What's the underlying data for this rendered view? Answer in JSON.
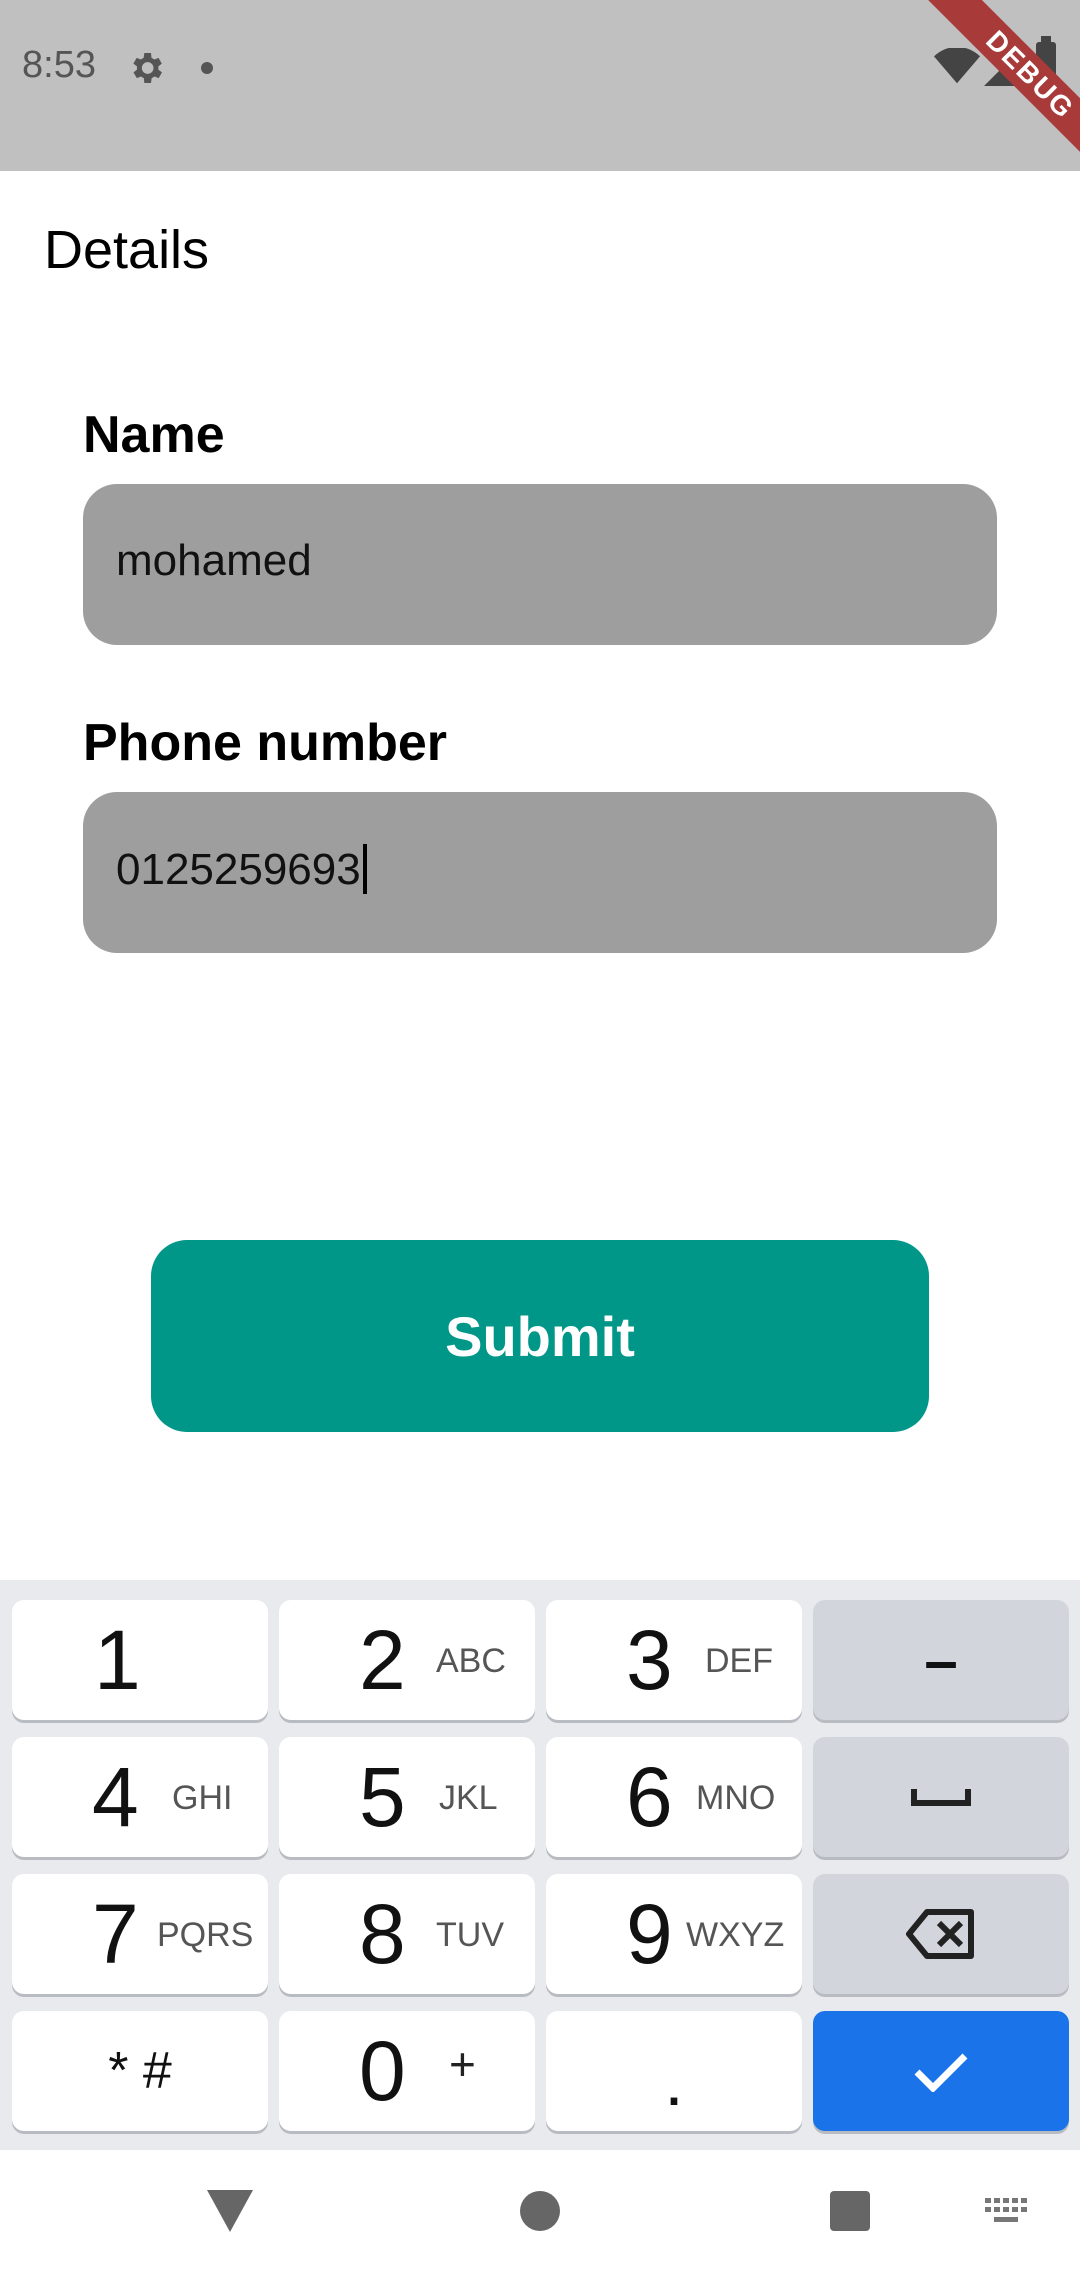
{
  "status_bar": {
    "time": "8:53",
    "icons": [
      "settings-icon",
      "dot-icon",
      "wifi-icon",
      "signal-icon",
      "battery-icon"
    ],
    "debug_banner": "DEBUG"
  },
  "app_bar": {
    "title": "Details"
  },
  "form": {
    "name_label": "Name",
    "name_value": "mohamed",
    "phone_label": "Phone number",
    "phone_value": "0125259693",
    "submit_label": "Submit"
  },
  "keyboard": {
    "rows": [
      [
        {
          "digit": "1",
          "letters": ""
        },
        {
          "digit": "2",
          "letters": "ABC"
        },
        {
          "digit": "3",
          "letters": "DEF"
        },
        {
          "symbol": "–"
        }
      ],
      [
        {
          "digit": "4",
          "letters": "GHI"
        },
        {
          "digit": "5",
          "letters": "JKL"
        },
        {
          "digit": "6",
          "letters": "MNO"
        },
        {
          "icon": "space-icon"
        }
      ],
      [
        {
          "digit": "7",
          "letters": "PQRS"
        },
        {
          "digit": "8",
          "letters": "TUV"
        },
        {
          "digit": "9",
          "letters": "WXYZ"
        },
        {
          "icon": "backspace-icon"
        }
      ],
      [
        {
          "symbol": "* #"
        },
        {
          "digit": "0",
          "letters": "+"
        },
        {
          "symbol": "."
        },
        {
          "icon": "check-icon"
        }
      ]
    ]
  },
  "nav_bar": {
    "icons": [
      "back-icon",
      "home-icon",
      "recents-icon",
      "keyboard-switch-icon"
    ]
  },
  "colors": {
    "status_bar_bg": "#c0c0c0",
    "field_bg": "#9e9e9e",
    "submit_bg": "#009688",
    "keyboard_bg": "#e8eaed",
    "done_key_bg": "#1a73e8",
    "debug_banner_bg": "#a83a3a"
  }
}
